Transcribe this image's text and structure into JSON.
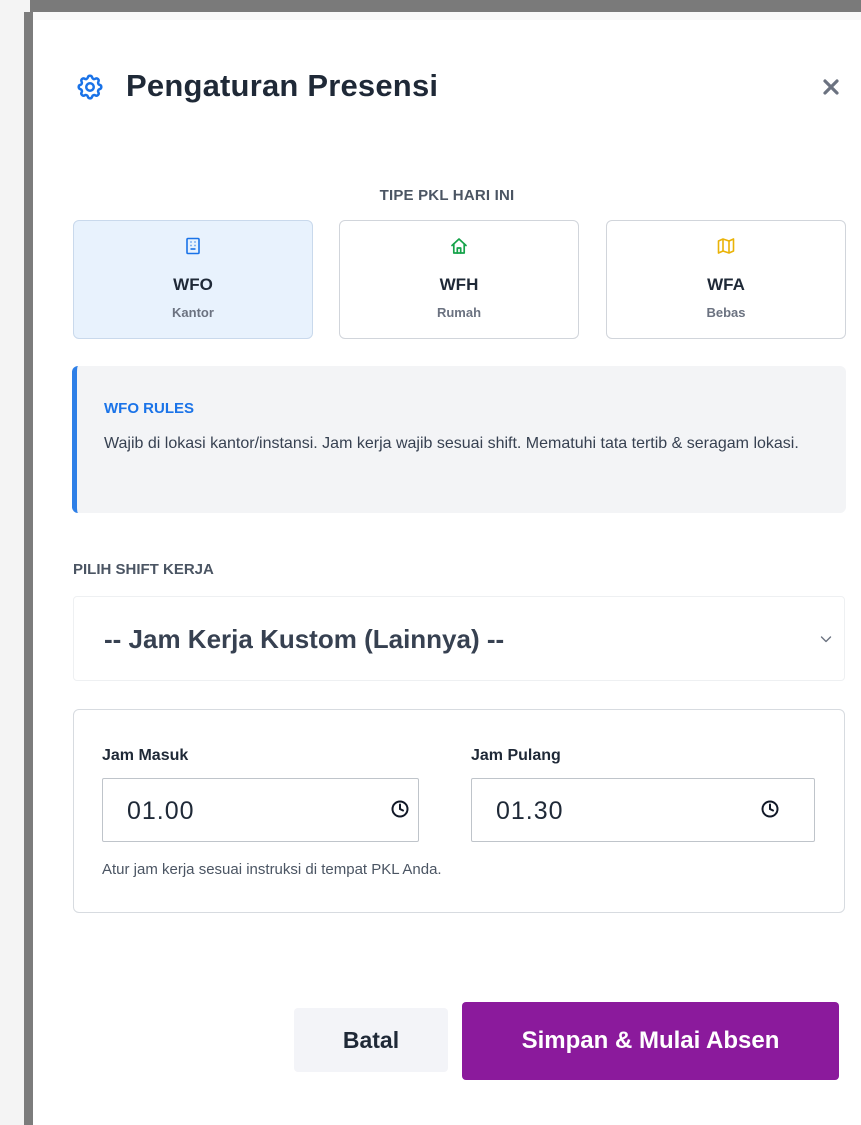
{
  "header": {
    "title": "Pengaturan Presensi",
    "icon": "gear-icon",
    "close_icon": "close-icon"
  },
  "type_section": {
    "label": "TIPE PKL HARI INI",
    "options": [
      {
        "id": "wfo",
        "title": "WFO",
        "subtitle": "Kantor",
        "icon": "building-icon",
        "color": "#1a73e8",
        "selected": true
      },
      {
        "id": "wfh",
        "title": "WFH",
        "subtitle": "Rumah",
        "icon": "home-icon",
        "color": "#16a34a",
        "selected": false
      },
      {
        "id": "wfa",
        "title": "WFA",
        "subtitle": "Bebas",
        "icon": "map-icon",
        "color": "#eab308",
        "selected": false
      }
    ]
  },
  "rules": {
    "title": "WFO RULES",
    "text": "Wajib di lokasi kantor/instansi. Jam kerja wajib sesuai shift. Mematuhi tata tertib & seragam lokasi."
  },
  "shift": {
    "label": "PILIH SHIFT KERJA",
    "selected": "-- Jam Kerja Kustom (Lainnya) --"
  },
  "time": {
    "in_label": "Jam Masuk",
    "in_value": "01.00",
    "out_label": "Jam Pulang",
    "out_value": "01.30",
    "hint": "Atur jam kerja sesuai instruksi di tempat PKL Anda."
  },
  "footer": {
    "cancel_label": "Batal",
    "submit_label": "Simpan & Mulai Absen"
  },
  "colors": {
    "accent": "#1a73e8",
    "primary_button": "#8b1a9c",
    "selected_card_bg": "#e8f2fd"
  }
}
